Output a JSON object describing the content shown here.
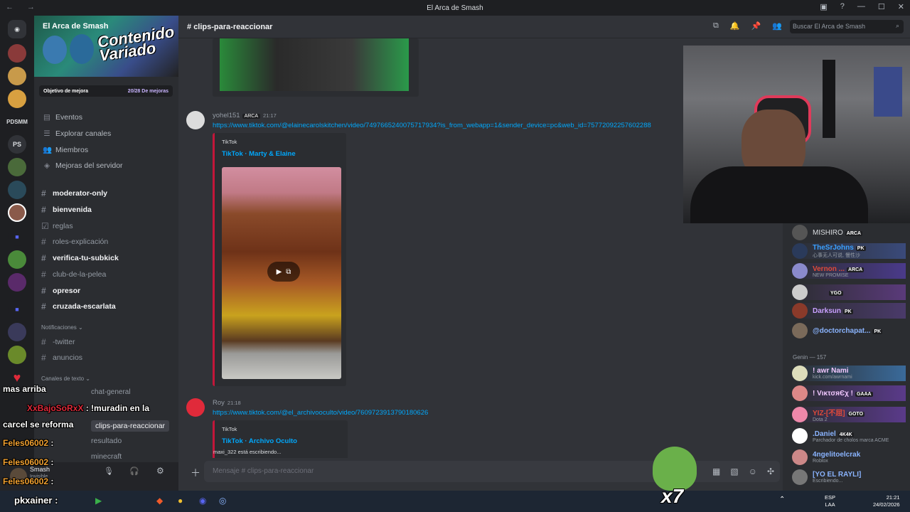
{
  "window": {
    "title": "El Arca de Smash"
  },
  "server_list": [
    "PDSMM",
    "PS"
  ],
  "sidebar": {
    "server_name": "El Arca de Smash",
    "banner_text": "Contenido Variado",
    "boost_label": "Objetivo de mejora",
    "boost_count": "20/28 De mejoras",
    "menu": [
      "Eventos",
      "Explorar canales",
      "Miembros",
      "Mejoras del servidor"
    ],
    "channels": [
      "moderator-only",
      "bienvenida",
      "reglas",
      "roles-explicación",
      "verifica-tu-subkick",
      "club-de-la-pelea",
      "opresor",
      "cruzada-escarlata"
    ],
    "cat_notif": "Notificaciones",
    "notif_channels": [
      "-twitter",
      "anuncios"
    ],
    "cat_text": "Canales de texto",
    "text_channels": [
      "chat-general",
      "clips-para-reaccionar",
      "resultado",
      "minecraft"
    ],
    "user_name": "Smash",
    "user_status": "Invisible"
  },
  "header": {
    "channel": "clips-para-reaccionar",
    "search_placeholder": "Buscar El Arca de Smash"
  },
  "messages": [
    {
      "author": "yohel151",
      "tag": "ARCA",
      "time": "21:17",
      "link": "https://www.tiktok.com/@elainecarolskitchen/video/7497665240075717934?is_from_webapp=1&sender_device=pc&web_id=75772092257602288",
      "provider": "TikTok",
      "embed_title": "TikTok · Marty & Elaine"
    },
    {
      "author": "Roy",
      "time": "21:18",
      "link": "https://www.tiktok.com/@el_archivooculto/video/7609723913790180626",
      "provider": "TikTok",
      "embed_title": "TikTok · Archivo Oculto"
    }
  ],
  "typing": "maxi_322 está escribiendo...",
  "composer_placeholder": "Mensaje # clips-para-reaccionar",
  "members": {
    "top": [
      {
        "name": "MISHIRO",
        "tag": "ARCA",
        "status": ""
      },
      {
        "name": "TheSrJohns",
        "tag": "PK",
        "status": "心事无人可说, 慢性沙"
      },
      {
        "name": "Vernon ...",
        "tag": "ARCA",
        "status": "NEW PROMISE"
      },
      {
        "name": "",
        "tag": "YGO",
        "status": ""
      },
      {
        "name": "Darksun",
        "tag": "PK",
        "status": ""
      },
      {
        "name": "@doctorchapat...",
        "tag": "PK",
        "status": ""
      }
    ],
    "role_header": "Genin — 157",
    "genin": [
      {
        "name": "! awr Nami",
        "tag": "",
        "status": "kick.com/awrnami"
      },
      {
        "name": "! VικτσяЄχ !",
        "tag": "GAAA",
        "status": ""
      },
      {
        "name": "YIZ-[不屈]",
        "tag": "GOTO",
        "status": "Dota 2"
      },
      {
        "name": ".Daniel",
        "tag": "4K4K",
        "status": "Parchador de cholos marca ACME"
      },
      {
        "name": "4ngelitoelcrak",
        "tag": "",
        "status": "Roblox"
      },
      {
        "name": "[YO EL RAYLI]",
        "tag": "",
        "status": "Escribiendo..."
      }
    ]
  },
  "stream_chat": [
    {
      "text": "mas arriba"
    },
    {
      "user": "XxBajoSoRxX",
      "text": ": !muradin en la"
    },
    {
      "text": "carcel se reforma"
    },
    {
      "user": "Feles06002",
      "text": ":"
    },
    {
      "user": "Feles06002",
      "text": ":"
    },
    {
      "user": "Feles06002",
      "text": ":"
    },
    {
      "user": "pkxainer",
      "text": ":"
    }
  ],
  "frog_text": "x7",
  "taskbar": {
    "lang": "ESP",
    "layout": "LAA",
    "time": "21:21",
    "date": "24/02/2026"
  }
}
